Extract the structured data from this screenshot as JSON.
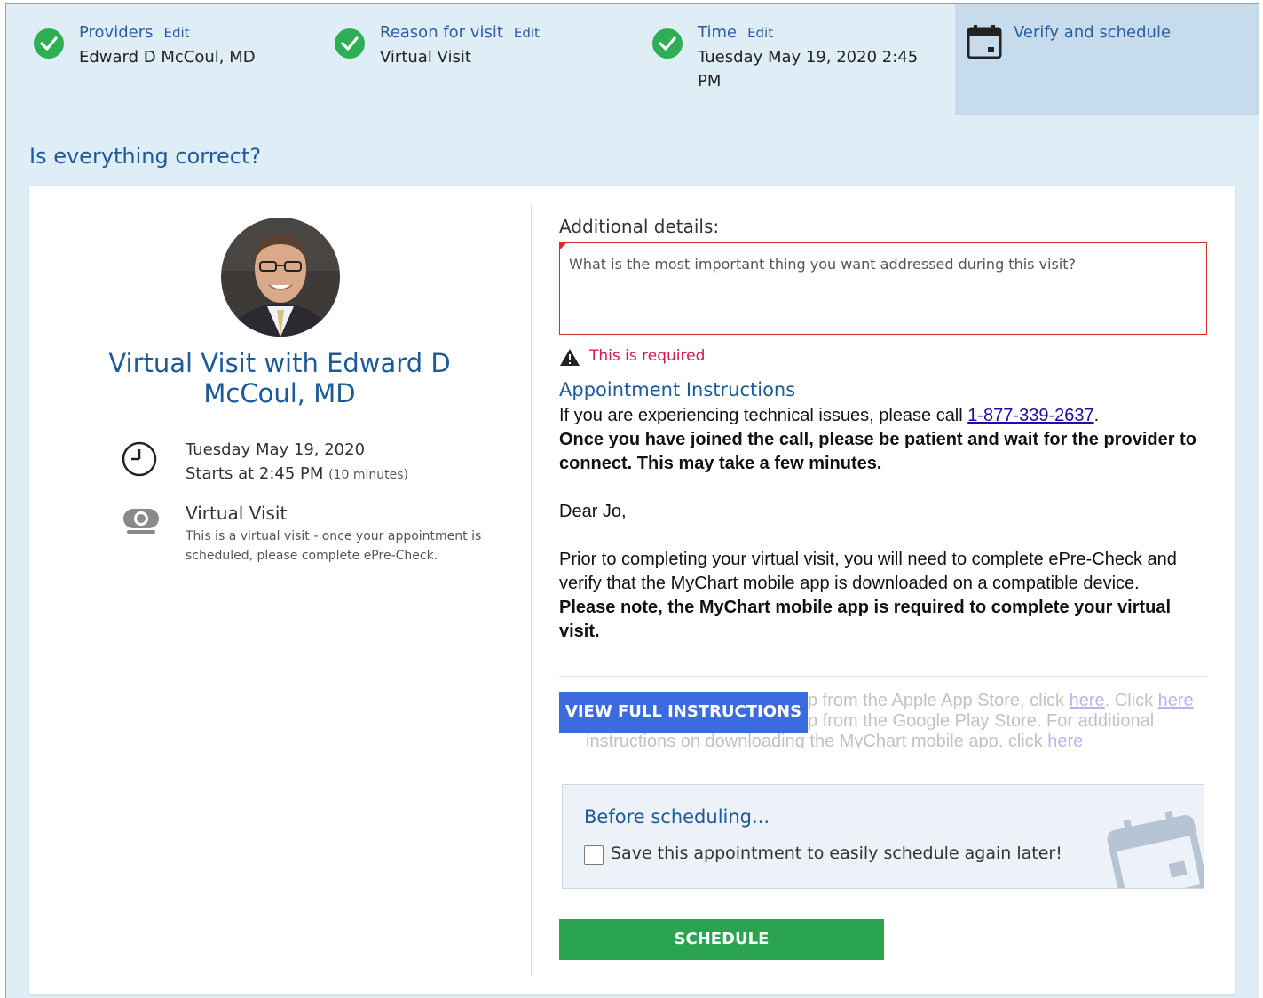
{
  "steps": [
    {
      "label": "Providers",
      "edit": "Edit",
      "value": "Edward D McCoul, MD"
    },
    {
      "label": "Reason for visit",
      "edit": "Edit",
      "value": "Virtual Visit"
    },
    {
      "label": "Time",
      "edit": "Edit",
      "value": "Tuesday May 19, 2020 2:45 PM"
    }
  ],
  "active_step": {
    "label": "Verify and schedule"
  },
  "question": "Is everything correct?",
  "summary": {
    "title": "Virtual Visit with Edward D McCoul, MD",
    "date": "Tuesday May 19, 2020",
    "time_prefix": "Starts at 2:45 PM",
    "duration": "(10 minutes)",
    "visit_type": "Virtual Visit",
    "visit_desc": "This is a virtual visit - once your appointment is scheduled, please complete ePre-Check."
  },
  "details": {
    "label": "Additional details:",
    "placeholder": "What is the most important thing you want addressed during this visit?",
    "error": "This is required"
  },
  "instructions": {
    "title": "Appointment Instructions",
    "tech_prefix": "If you are experiencing technical issues, please call ",
    "phone": "1-877-339-2637",
    "tech_suffix": ".",
    "patience": "Once you have joined the call, please  be patient and wait for the provider to connect. This may take a few minutes.",
    "greeting": "Dear Jo,",
    "prior": "Prior to completing your virtual visit, you will need to complete ePre-Check and verify that the MyChart mobile app is downloaded on a compatible device.",
    "note": "Please note, the MyChart mobile app is required to complete your virtual visit.",
    "faded_1": "p from the Apple App Store, click ",
    "faded_here": "here",
    "faded_2": ". Click ",
    "faded_3": "p from the Google Play Store. For additional",
    "faded_4": "instructions on downloading the MyChart mobile app, click ",
    "view_button": "VIEW FULL INSTRUCTIONS"
  },
  "before": {
    "title": "Before scheduling...",
    "checkbox_label": "Save this appointment to easily schedule again later!"
  },
  "schedule_button": "SCHEDULE",
  "colors": {
    "accent_blue": "#1d5a9a",
    "success_green": "#2aa44f",
    "error_red": "#d6194a",
    "button_blue": "#3c6be0"
  }
}
